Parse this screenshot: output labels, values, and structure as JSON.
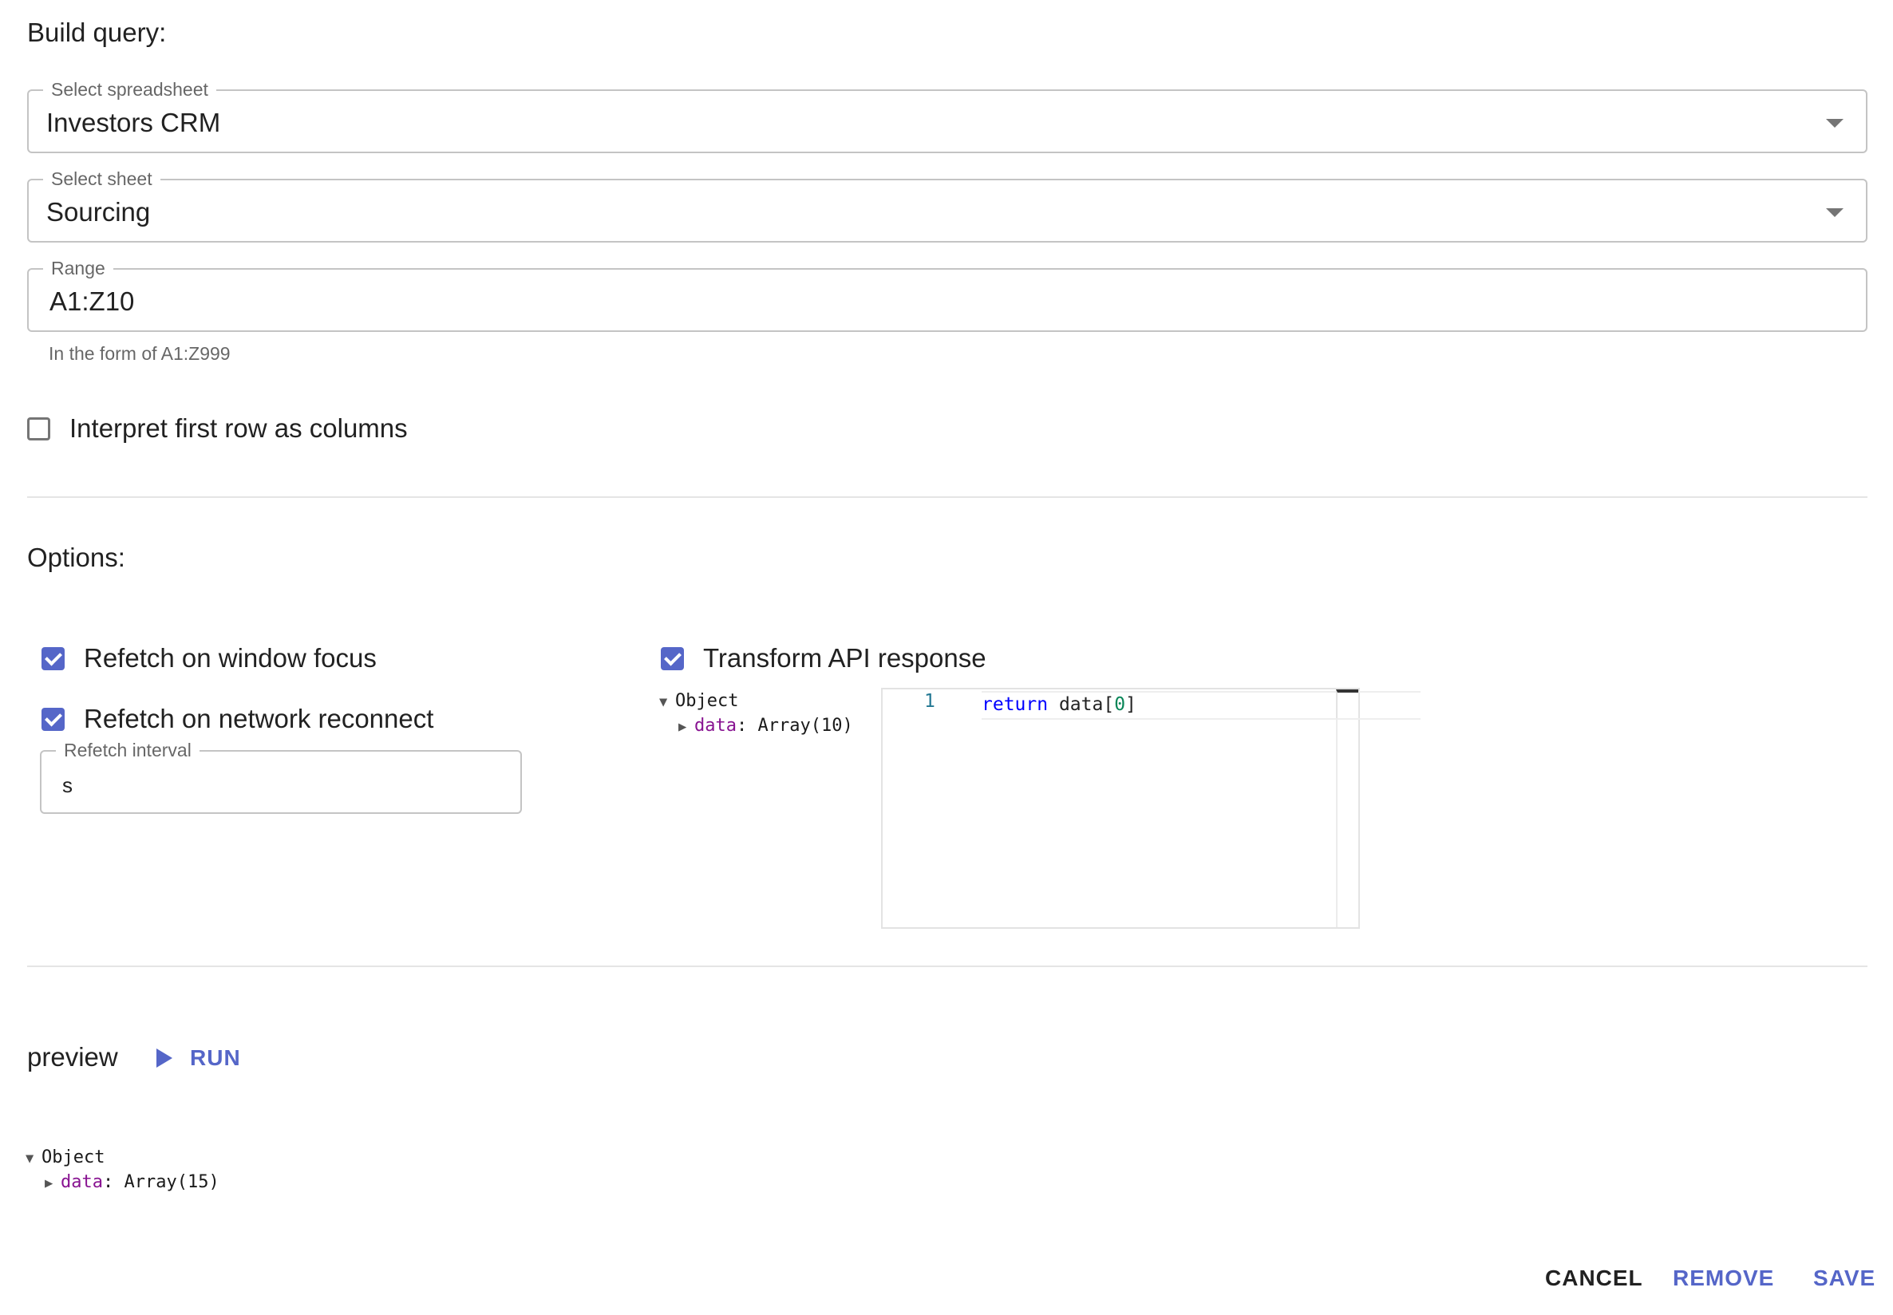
{
  "build_query": {
    "title": "Build query:",
    "spreadsheet": {
      "label": "Select spreadsheet",
      "value": "Investors CRM"
    },
    "sheet": {
      "label": "Select sheet",
      "value": "Sourcing"
    },
    "range": {
      "label": "Range",
      "value": "A1:Z10",
      "helper": "In the form of A1:Z999"
    },
    "first_row_columns": {
      "label": "Interpret first row as columns",
      "checked": false
    }
  },
  "options": {
    "title": "Options:",
    "refetch_focus": {
      "label": "Refetch on window focus",
      "checked": true
    },
    "refetch_reconnect": {
      "label": "Refetch on network reconnect",
      "checked": true
    },
    "refetch_interval": {
      "label": "Refetch interval",
      "value": "s"
    },
    "transform": {
      "label": "Transform API response",
      "checked": true
    },
    "transform_inspector": {
      "root": "Object",
      "key": "data",
      "value": "Array(10)"
    },
    "editor": {
      "line_number": "1",
      "code_keyword": "return",
      "code_rest": " data[",
      "code_index": "0",
      "code_close": "]"
    }
  },
  "preview": {
    "title": "preview",
    "run_label": "RUN",
    "inspector": {
      "root": "Object",
      "key": "data",
      "value": "Array(15)"
    }
  },
  "actions": {
    "cancel": "CANCEL",
    "remove": "REMOVE",
    "save": "SAVE"
  },
  "colors": {
    "accent": "#5566c8",
    "object_key": "#881391",
    "code_keyword": "#0000ff",
    "code_number": "#098658"
  }
}
